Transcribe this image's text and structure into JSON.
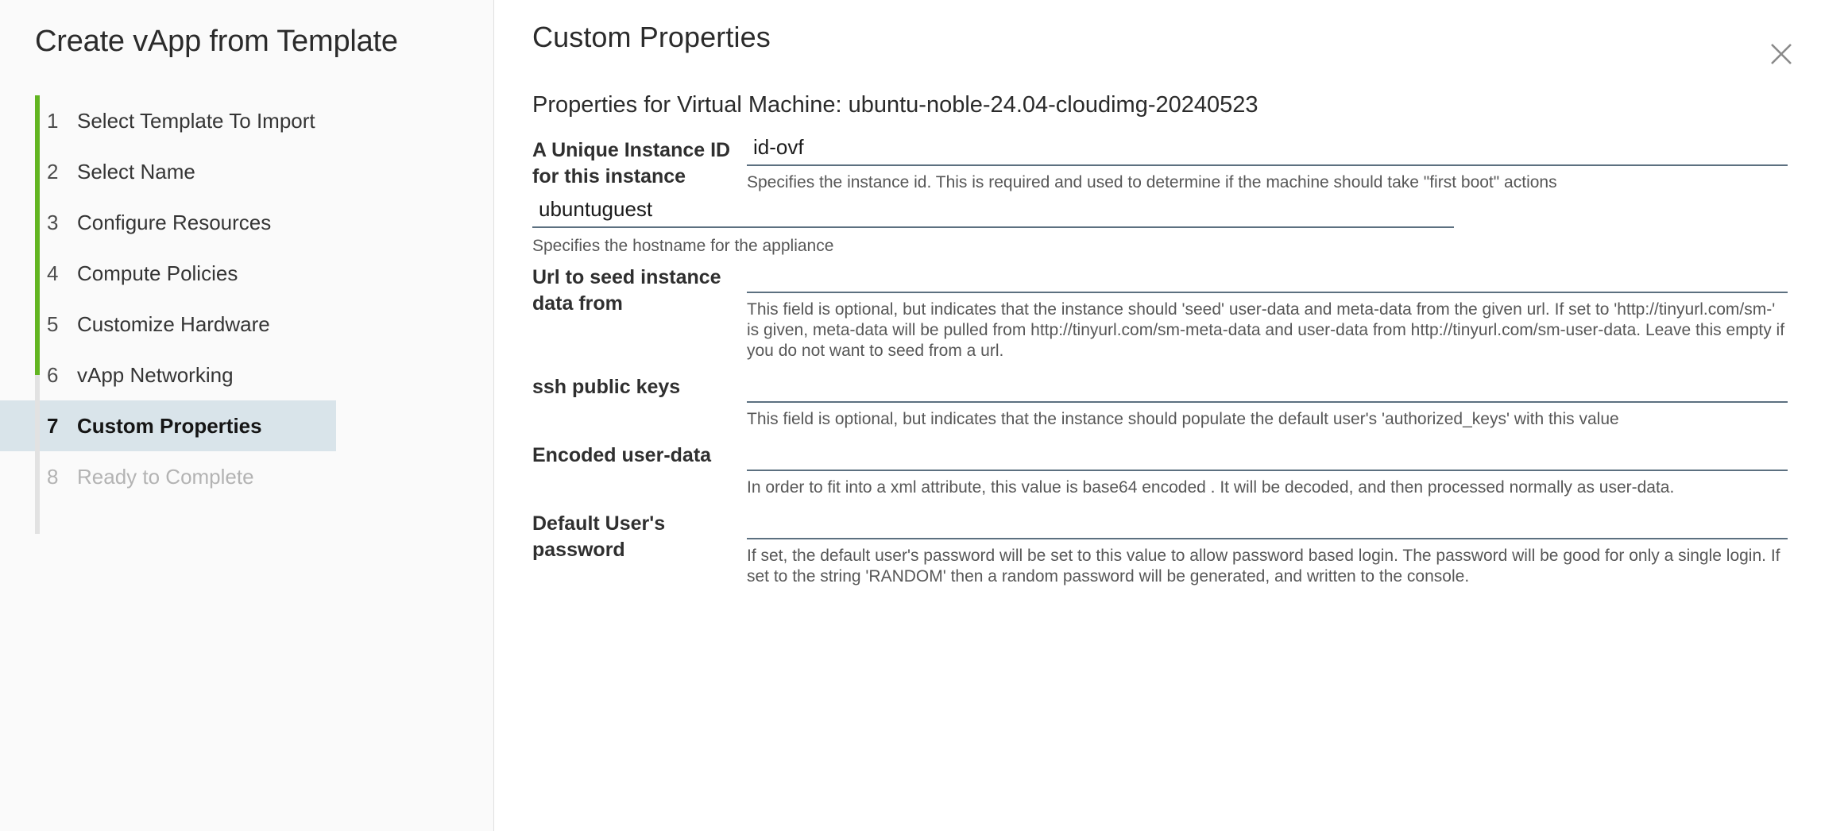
{
  "sidebar": {
    "title": "Create vApp from Template",
    "steps": [
      {
        "num": "1",
        "label": "Select Template To Import",
        "state": "done"
      },
      {
        "num": "2",
        "label": "Select Name",
        "state": "done"
      },
      {
        "num": "3",
        "label": "Configure Resources",
        "state": "done"
      },
      {
        "num": "4",
        "label": "Compute Policies",
        "state": "done"
      },
      {
        "num": "5",
        "label": "Customize Hardware",
        "state": "done"
      },
      {
        "num": "6",
        "label": "vApp Networking",
        "state": "done"
      },
      {
        "num": "7",
        "label": "Custom Properties",
        "state": "active"
      },
      {
        "num": "8",
        "label": "Ready to Complete",
        "state": "disabled"
      }
    ],
    "progress_color": "#62b521",
    "active_bg": "#d9e4ea"
  },
  "main": {
    "title": "Custom Properties",
    "subtitle": "Properties for Virtual Machine: ubuntu-noble-24.04-cloudimg-20240523",
    "close_icon": "close-icon",
    "fields": {
      "instance_id": {
        "label": "A Unique Instance ID for this instance",
        "value": "id-ovf",
        "help": "Specifies the instance id. This is required and used to determine if the machine should take \"first boot\" actions"
      },
      "hostname": {
        "label": "",
        "value": "ubuntuguest",
        "help": "Specifies the hostname for the appliance"
      },
      "seed_url": {
        "label": "Url to seed instance data from",
        "value": "",
        "help": "This field is optional, but indicates that the instance should 'seed' user-data and meta-data from the given url. If set to 'http://tinyurl.com/sm-' is given, meta-data will be pulled from http://tinyurl.com/sm-meta-data and user-data from http://tinyurl.com/sm-user-data. Leave this empty if you do not want to seed from a url."
      },
      "ssh_keys": {
        "label": "ssh public keys",
        "value": "",
        "help": "This field is optional, but indicates that the instance should populate the default user's 'authorized_keys' with this value"
      },
      "user_data": {
        "label": "Encoded user-data",
        "value": "",
        "help": "In order to fit into a xml attribute, this value is base64 encoded . It will be decoded, and then processed normally as user-data."
      },
      "password": {
        "label": "Default User's password",
        "value": "",
        "help": "If set, the default user's password will be set to this value to allow password based login. The password will be good for only a single login. If set to the string 'RANDOM' then a random password will be generated, and written to the console."
      }
    }
  }
}
